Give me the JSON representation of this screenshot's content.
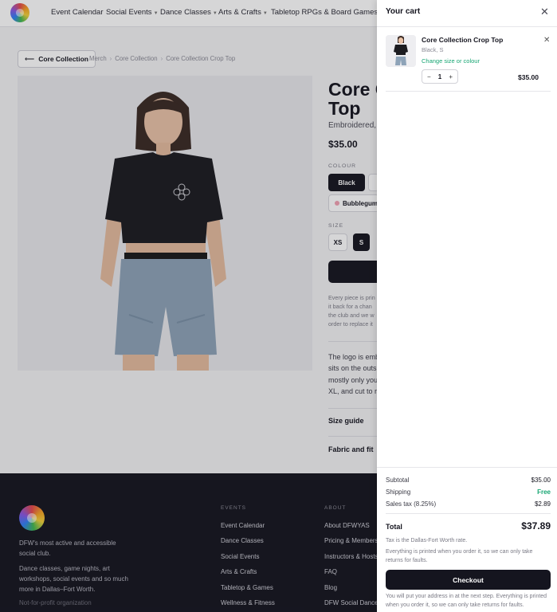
{
  "nav": {
    "links": [
      "Event Calendar",
      "Social Events",
      "Dance Classes",
      "Arts & Crafts",
      "Tabletop RPGs & Board Games"
    ]
  },
  "breadcrumb": {
    "back_label": "Core Collection",
    "items": [
      "Merch",
      "Core Collection",
      "Core Collection Crop Top"
    ]
  },
  "product": {
    "title": "Core Collection Crop Top",
    "subtitle": "Embroidered,",
    "price": "$35.00",
    "colour_label": "COLOUR",
    "colours": [
      "Black",
      "Bubblegum"
    ],
    "size_label": "SIZE",
    "sizes": [
      "XS",
      "S"
    ],
    "note_lines": [
      "Every piece is prin",
      "it back for a chan",
      "the club and we w",
      "order to replace it"
    ],
    "description_lines": [
      "The logo is emb",
      "sits on the outs",
      "mostly only you",
      "XL, and cut to r"
    ],
    "accordions": [
      "Size guide",
      "Fabric and fit"
    ]
  },
  "footer": {
    "tagline": [
      "DFW's most active and accessible",
      "social club."
    ],
    "blurb": [
      "Dance classes, game nights, art",
      "workshops, social events and so much",
      "more in Dallas–Fort Worth."
    ],
    "org_type": "Not-for-profit organization",
    "events_heading": "EVENTS",
    "events_links": [
      "Event Calendar",
      "Dance Classes",
      "Social Events",
      "Arts & Crafts",
      "Tabletop & Games",
      "Wellness & Fitness"
    ],
    "about_heading": "ABOUT",
    "about_links": [
      "About DFWYAS",
      "Pricing & Members",
      "Instructors & Hosts",
      "FAQ",
      "Blog",
      "DFW Social Dance"
    ]
  },
  "cart": {
    "title": "Your cart",
    "item": {
      "name": "Core Collection Crop Top",
      "variant": "Black, S",
      "change_label": "Change size or colour",
      "quantity": "1",
      "price": "$35.00",
      "minus": "−",
      "plus": "+"
    },
    "summary": {
      "subtotal_label": "Subtotal",
      "subtotal_value": "$35.00",
      "shipping_label": "Shipping",
      "shipping_value": "Free",
      "tax_label": "Sales tax (8.25%)",
      "tax_value": "$2.89",
      "total_label": "Total",
      "total_value": "$37.89",
      "tax_note": "Tax is the Dallas-Fort Worth rate.",
      "print_note": [
        "Everything is printed when you order it, so we can only take",
        "returns for faults."
      ],
      "checkout_label": "Checkout",
      "address_note": [
        "You will put your address in at the next step. Everything is printed",
        "when you order it, so we can only take returns for faults."
      ]
    }
  },
  "colors": {
    "accent_green": "#17a673",
    "dark": "#15151f"
  }
}
